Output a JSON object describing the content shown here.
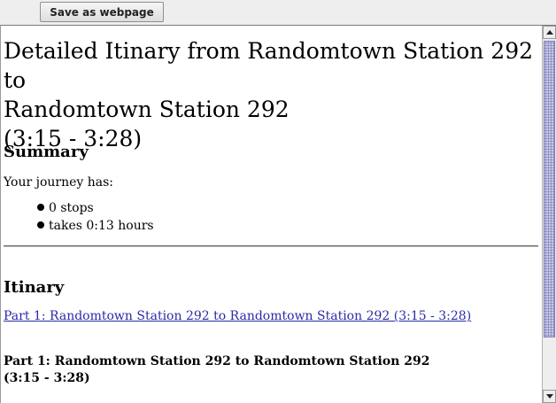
{
  "toolbar": {
    "save_label": "Save as webpage"
  },
  "document": {
    "title_line1": "Detailed Itinary from Randomtown Station 292 to",
    "title_line2": "Randomtown Station 292",
    "title_line3": "(3:15 - 3:28)",
    "summary": {
      "heading": "Summary",
      "intro": "Your journey has:",
      "items": [
        {
          "text": "0 stops"
        },
        {
          "text": "takes 0:13 hours"
        }
      ]
    },
    "itinerary": {
      "heading": "Itinary",
      "link_text": "Part 1: Randomtown Station 292 to Randomtown Station 292 (3:15 - 3:28)",
      "part_heading": "Part 1: Randomtown Station 292 to Randomtown Station 292",
      "part_time": "(3:15 - 3:28)"
    }
  },
  "colors": {
    "link": "#2a2aa8",
    "scroll_thumb": "#c6c6e6"
  },
  "icons": {
    "scroll_up": "triangle-up",
    "scroll_down": "triangle-down",
    "bullet": "filled-circle"
  }
}
